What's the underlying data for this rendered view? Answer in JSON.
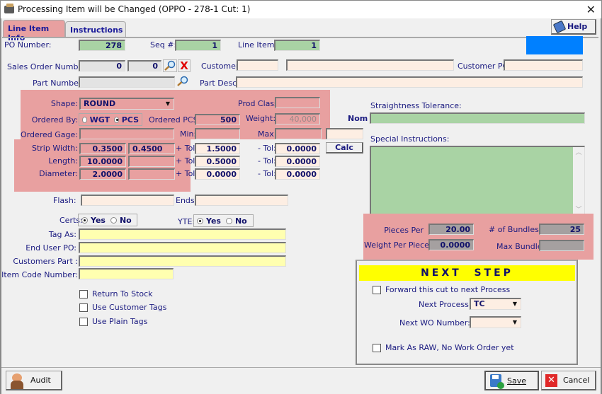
{
  "window": {
    "title": "Processing Item will be Changed  (OPPO - 278-1   Cut: 1)",
    "close_icon": "close-icon"
  },
  "tabs": [
    {
      "label": "Line Item Info",
      "active": true
    },
    {
      "label": "Instructions",
      "active": false
    }
  ],
  "help_button": {
    "label": "Help",
    "icon": "help-book-icon"
  },
  "accent_color": "#0080ff",
  "header": {
    "po_number_label": "PO Number:",
    "po_number": "278",
    "seq_label": "Seq #:",
    "seq": "1",
    "line_item_label": "Line Item:",
    "line_item": "1"
  },
  "order": {
    "sales_order_label": "Sales Order Number:",
    "sales_order_1": "0",
    "sales_order_2": "0",
    "customer_label": "Customer:",
    "customer_code": "",
    "customer_name": "",
    "customer_po_label": "Customer PO:",
    "customer_po": "",
    "part_number_label": "Part Number:",
    "part_number": "",
    "part_desc_label": "Part Desc:",
    "part_desc": ""
  },
  "specs": {
    "shape_label": "Shape:",
    "shape": "ROUND",
    "prod_class_label": "Prod Class",
    "prod_class": "",
    "ordered_by_label": "Ordered By:",
    "ordered_by_options": [
      "WGT",
      "PCS"
    ],
    "ordered_by_selected": "PCS",
    "ordered_pcs_label": "Ordered PCS:",
    "ordered_pcs": "500",
    "weight_label": "Weight:",
    "weight": "40,000",
    "nom_label": "Nom",
    "ordered_gage_label": "Ordered Gage:",
    "ordered_gage": "",
    "min_label": "Min:",
    "min": "",
    "max_label": "Max:",
    "max": "",
    "nom": "",
    "calc_label": "Calc",
    "plus_tol_label": "+ Tol:",
    "minus_tol_label": "- Tol:",
    "rows": [
      {
        "label": "Strip Width:",
        "v1": "0.3500",
        "v2": "0.4500",
        "plus_tol": "1.5000",
        "minus_tol": "0.0000"
      },
      {
        "label": "Length:",
        "v1": "10.0000",
        "v2": "",
        "plus_tol": "0.5000",
        "minus_tol": "0.0000"
      },
      {
        "label": "Diameter:",
        "v1": "2.0000",
        "v2": "",
        "plus_tol": "0.0000",
        "minus_tol": "0.0000"
      }
    ]
  },
  "straightness": {
    "label": "Straightness Tolerance:",
    "value": ""
  },
  "special_instructions": {
    "label": "Special Instructions:",
    "value": ""
  },
  "misc": {
    "flash_label": "Flash:",
    "flash": "",
    "ends_label": "Ends:",
    "ends": "",
    "certs_label": "Certs:",
    "certs_options": [
      "Yes",
      "No"
    ],
    "certs_selected": "Yes",
    "yte_label": "YTE:",
    "yte_options": [
      "Yes",
      "No"
    ],
    "yte_selected": "Yes",
    "tag_as_label": "Tag As:",
    "tag_as": "",
    "end_user_po_label": "End User PO:",
    "end_user_po": "",
    "customers_part_label": "Customers Part :",
    "customers_part": "",
    "item_code_label": "Item Code Number:",
    "item_code": ""
  },
  "checkboxes": [
    {
      "label": "Return To Stock",
      "checked": false
    },
    {
      "label": "Use Customer Tags",
      "checked": false
    },
    {
      "label": "Use Plain Tags",
      "checked": false
    }
  ],
  "bundles": {
    "pieces_per_label": "Pieces Per",
    "pieces_per": "20.00",
    "num_bundles_label": "# of Bundles:",
    "num_bundles": "25",
    "weight_per_piece_label": "Weight Per Piece:",
    "weight_per_piece": "0.0000",
    "max_bundle_label": "Max Bundle",
    "max_bundle": ""
  },
  "next_step": {
    "title": "NEXT  STEP",
    "forward_label": "Forward this cut to next Process",
    "forward_checked": false,
    "next_process_label": "Next Process:",
    "next_process": "TC",
    "next_wo_label": "Next WO Number:",
    "next_wo": "",
    "mark_raw_label": "Mark As RAW, No Work Order yet",
    "mark_raw_checked": false
  },
  "footer": {
    "audit_label": "Audit",
    "save_label": "Save",
    "cancel_label": "Cancel"
  }
}
